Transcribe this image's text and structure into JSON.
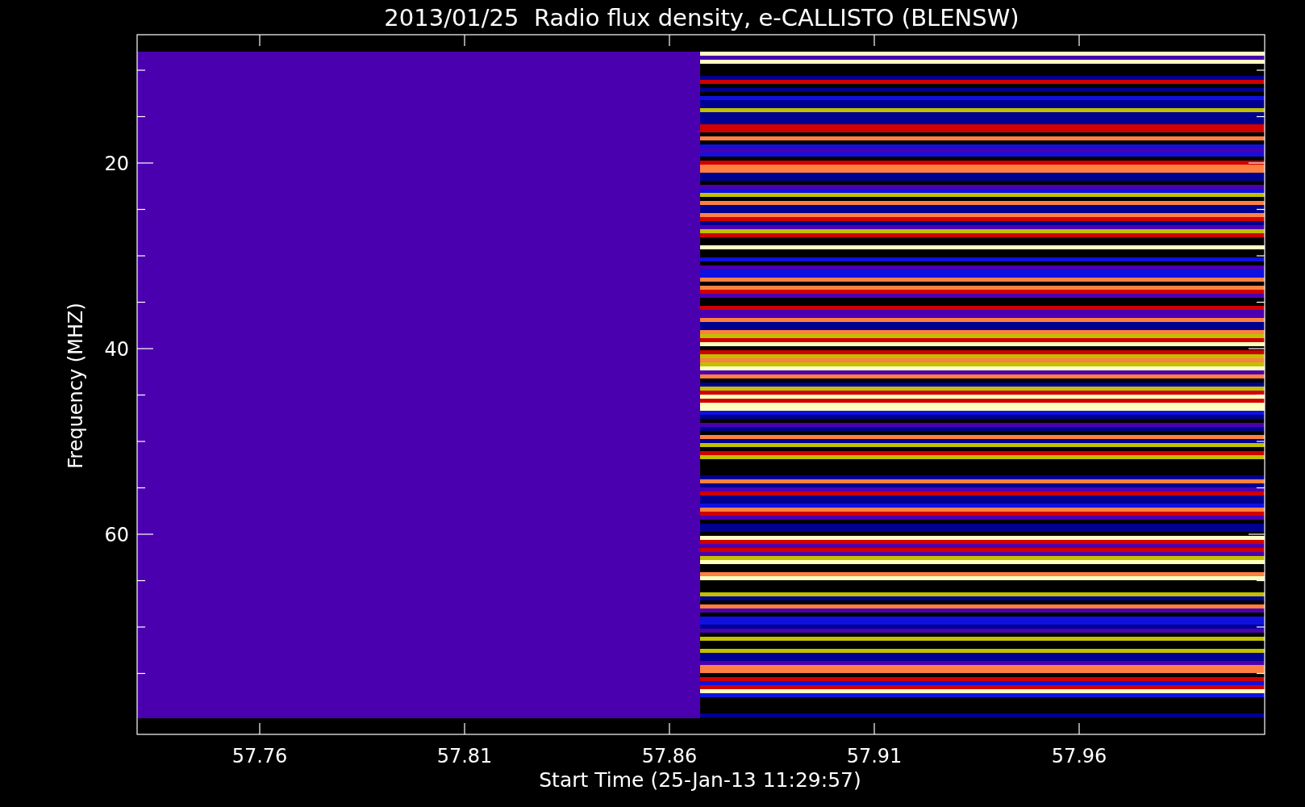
{
  "title": "2013/01/25  Radio flux density, e-CALLISTO (BLENSW)",
  "x_axis": {
    "label": "Start Time (25-Jan-13 11:29:57)",
    "ticks": [
      "57.76",
      "57.81",
      "57.86",
      "57.91",
      "57.96"
    ]
  },
  "y_axis": {
    "label": "Frequency (MHZ)",
    "ticks": [
      "20",
      "40",
      "60"
    ]
  }
}
